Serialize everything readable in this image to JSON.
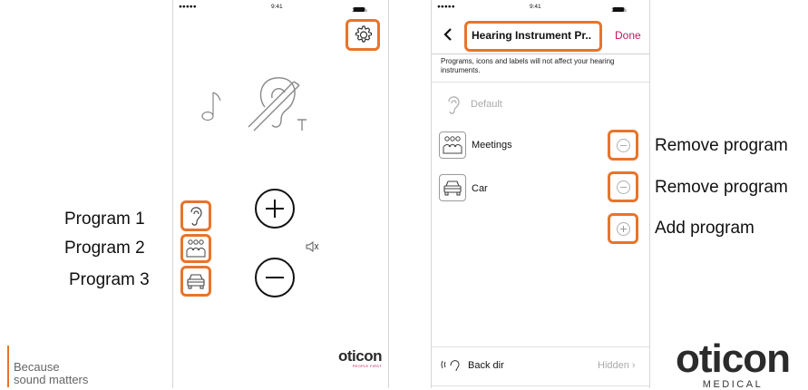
{
  "status_bar": {
    "signal": "●●●●● ",
    "time": "9:41",
    "battery": "100%"
  },
  "left_screen": {
    "brand_logo": "oticon",
    "brand_tagline": "PEOPLE FIRST"
  },
  "right_screen": {
    "nav": {
      "back_icon": "chevron-left-icon",
      "title": "Hearing Instrument Pr..",
      "done_label": "Done"
    },
    "notice": "Programs, icons and labels will not affect your hearing instruments.",
    "programs": [
      {
        "label": "Default",
        "icon": "ear-icon"
      },
      {
        "label": "Meetings",
        "icon": "people-icon"
      },
      {
        "label": "Car",
        "icon": "car-icon"
      }
    ],
    "back_dir": {
      "label": "Back dir",
      "value": "Hidden"
    }
  },
  "annotations": {
    "program_1": "Program 1",
    "program_2": "Program 2",
    "program_3": "Program 3",
    "remove_program_1": "Remove program",
    "remove_program_2": "Remove program",
    "add_program": "Add program"
  },
  "branding": {
    "slogan_line1": "Because",
    "slogan_line2": "sound matters",
    "oticon_medical_logo": "oticon",
    "oticon_medical_sub": "MEDICAL"
  },
  "colors": {
    "highlight": "#e8742a",
    "done": "#c2185b",
    "slogan_bar": "#e8742a"
  }
}
